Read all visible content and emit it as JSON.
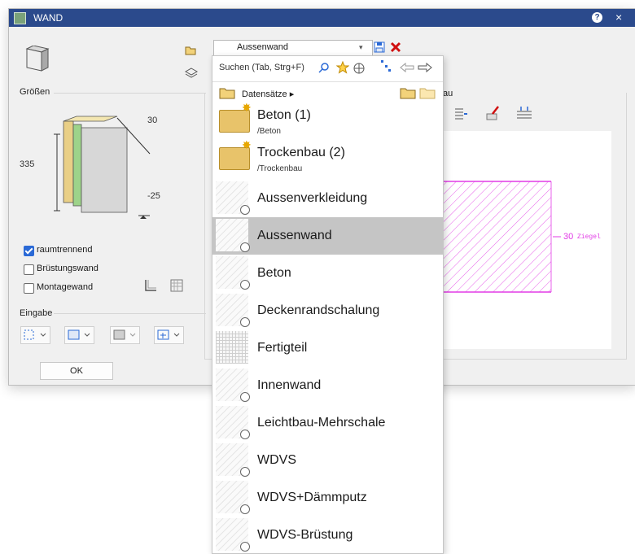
{
  "window": {
    "title": "WAND",
    "help_label": "?",
    "close_label": "×",
    "ok_label": "OK"
  },
  "left_panel": {
    "groessen_label": "Größen",
    "dim_top": "30",
    "dim_left": "335",
    "dim_right": "-25",
    "checkboxes": [
      {
        "label": "raumtrennend",
        "checked": true
      },
      {
        "label": "Brüstungswand",
        "checked": false
      },
      {
        "label": "Montagewand",
        "checked": false
      }
    ],
    "eingabe_label": "Eingabe"
  },
  "combo": {
    "value": "Aussenwand"
  },
  "popup": {
    "search_placeholder": "Suchen (Tab, Strg+F)",
    "breadcrumb": "Datensätze ▸",
    "folders": [
      {
        "name": "Beton (1)",
        "path": "/Beton"
      },
      {
        "name": "Trockenbau (2)",
        "path": "/Trockenbau"
      }
    ],
    "items": [
      {
        "name": "Aussenverkleidung",
        "selected": false
      },
      {
        "name": "Aussenwand",
        "selected": true
      },
      {
        "name": "Beton",
        "selected": false
      },
      {
        "name": "Deckenrandschalung",
        "selected": false
      },
      {
        "name": "Fertigteil",
        "selected": false
      },
      {
        "name": "Innenwand",
        "selected": false
      },
      {
        "name": "Leichtbau-Mehrschale",
        "selected": false
      },
      {
        "name": "WDVS",
        "selected": false
      },
      {
        "name": "WDVS+Dämmputz",
        "selected": false
      },
      {
        "name": "WDVS-Brüstung",
        "selected": false
      }
    ]
  },
  "preview": {
    "section_suffix": "au",
    "dim_value": "30",
    "material_label": "Ziegel",
    "hatch_color": "#e23ce6"
  }
}
